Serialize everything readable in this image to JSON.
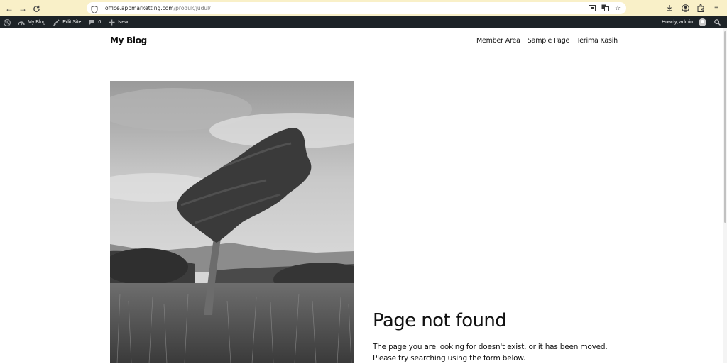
{
  "browser": {
    "url_host": "office.appmarketting.com",
    "url_path": "/produk/judul/"
  },
  "admin_bar": {
    "site_name": "My Blog",
    "edit_site": "Edit Site",
    "comments_count": "0",
    "new_label": "New",
    "howdy": "Howdy, admin"
  },
  "site": {
    "title": "My Blog",
    "nav": [
      "Member Area",
      "Sample Page",
      "Terima Kasih"
    ]
  },
  "not_found": {
    "title": "Page not found",
    "line1": "The page you are looking for doesn't exist, or it has been moved.",
    "line2": "Please try searching using the form below."
  },
  "icons": {
    "back": "back-arrow-icon",
    "forward": "forward-arrow-icon",
    "reload": "reload-icon",
    "shield": "shield-icon",
    "wordpress": "wordpress-logo-icon",
    "gauge": "dashboard-icon",
    "brush": "brush-icon",
    "comment": "comment-icon",
    "plus": "plus-icon",
    "search": "search-icon",
    "download": "download-icon",
    "account": "account-icon",
    "extensions": "extensions-icon",
    "menu": "menu-icon"
  }
}
